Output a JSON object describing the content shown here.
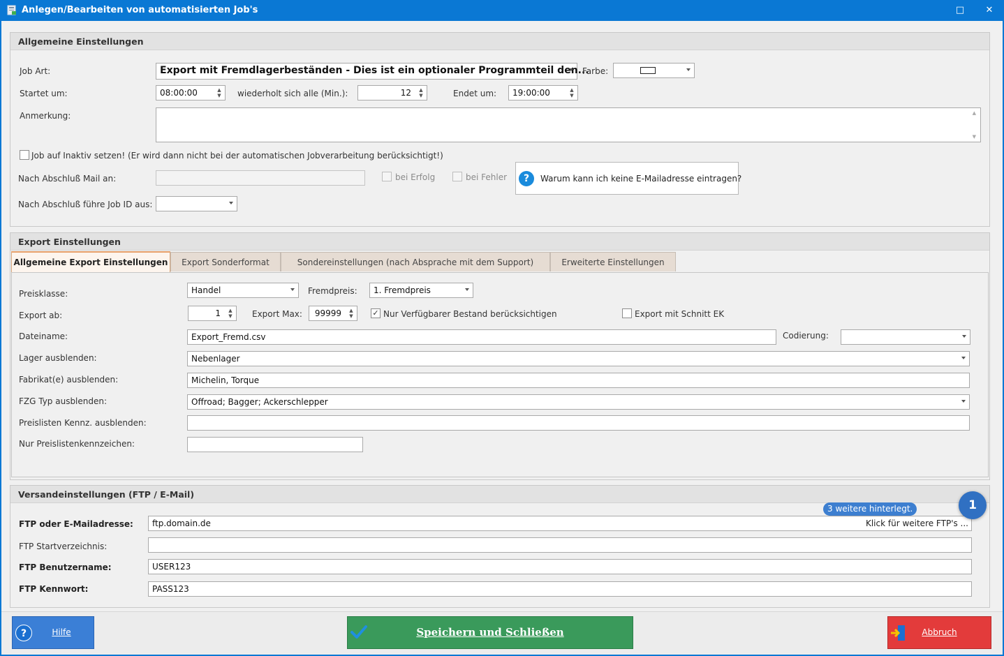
{
  "window": {
    "title": "Anlegen/Bearbeiten von automatisierten Job's",
    "maximize_glyph": "□",
    "close_glyph": "✕"
  },
  "general": {
    "header": "Allgemeine Einstellungen",
    "job_art_label": "Job Art:",
    "job_art_value": "Export mit Fremdlagerbeständen - Dies ist ein optionaler Programmteil den...",
    "farbe_label": "Farbe:",
    "start_label": "Startet um:",
    "start_value": "08:00:00",
    "repeat_label": "wiederholt sich alle (Min.):",
    "repeat_value": "12",
    "end_label": "Endet um:",
    "end_value": "19:00:00",
    "note_label": "Anmerkung:",
    "note_value": "",
    "inactive_label": "Job auf Inaktiv setzen! (Er wird dann nicht bei der automatischen Jobverarbeitung berücksichtigt!)",
    "mail_label": "Nach Abschluß Mail an:",
    "mail_value": "",
    "success_label": "bei Erfolg",
    "error_label": "bei Fehler",
    "help_question": "Warum kann ich keine E-Mailadresse eintragen?",
    "next_job_label": "Nach Abschluß führe Job ID aus:",
    "next_job_value": ""
  },
  "export": {
    "header": "Export Einstellungen",
    "tabs": [
      {
        "label": "Allgemeine Export Einstellungen",
        "active": true
      },
      {
        "label": "Export Sonderformat",
        "active": false
      },
      {
        "label": "Sondereinstellungen (nach Absprache mit dem Support)",
        "active": false
      },
      {
        "label": "Erweiterte Einstellungen",
        "active": false
      }
    ],
    "preisklasse_label": "Preisklasse:",
    "preisklasse_value": "Handel",
    "fremdpreis_label": "Fremdpreis:",
    "fremdpreis_value": "1. Fremdpreis",
    "export_ab_label": "Export ab:",
    "export_ab_value": "1",
    "export_max_label": "Export Max:",
    "export_max_value": "99999",
    "nur_verfuegbar_label": "Nur Verfügbarer Bestand berücksichtigen",
    "nur_verfuegbar_checked": true,
    "schnitt_ek_label": "Export mit Schnitt EK",
    "schnitt_ek_checked": false,
    "dateiname_label": "Dateiname:",
    "dateiname_value": "Export_Fremd.csv",
    "codierung_label": "Codierung:",
    "codierung_value": "",
    "lager_label": "Lager ausblenden:",
    "lager_value": "Nebenlager",
    "fabrikat_label": "Fabrikat(e) ausblenden:",
    "fabrikat_value": "Michelin, Torque",
    "fzg_label": "FZG Typ  ausblenden:",
    "fzg_value": "Offroad; Bagger; Ackerschlepper",
    "preisliste_label": "Preislisten Kennz. ausblenden:",
    "preisliste_value": "",
    "nur_preisliste_label": "Nur Preislistenkennzeichen:",
    "nur_preisliste_value": ""
  },
  "shipping": {
    "header": "Versandeinstellungen (FTP / E-Mail)",
    "address_label": "FTP oder E-Mailadresse:",
    "address_value": "ftp.domain.de",
    "more_ftp_text": "Klick für weitere FTP's ...",
    "more_count_text": "3 weitere hinterlegt.",
    "badge": "1",
    "startdir_label": "FTP Startverzeichnis:",
    "startdir_value": "",
    "user_label": "FTP Benutzername:",
    "user_value": "USER123",
    "pass_label": "FTP Kennwort:",
    "pass_value": "PASS123"
  },
  "buttons": {
    "help": "Hilfe",
    "save": "Speichern und Schließen",
    "cancel": "Abbruch"
  },
  "icons": {
    "app": "app-job-icon",
    "help": "question-circle-icon",
    "save": "checkmark-icon",
    "cancel": "exit-door-icon"
  },
  "colors": {
    "titlebar": "#0a78d4",
    "help_button": "#3b7fd6",
    "save_button": "#3a9a5b",
    "cancel_button": "#e33b3b",
    "badge": "#3070c2"
  }
}
